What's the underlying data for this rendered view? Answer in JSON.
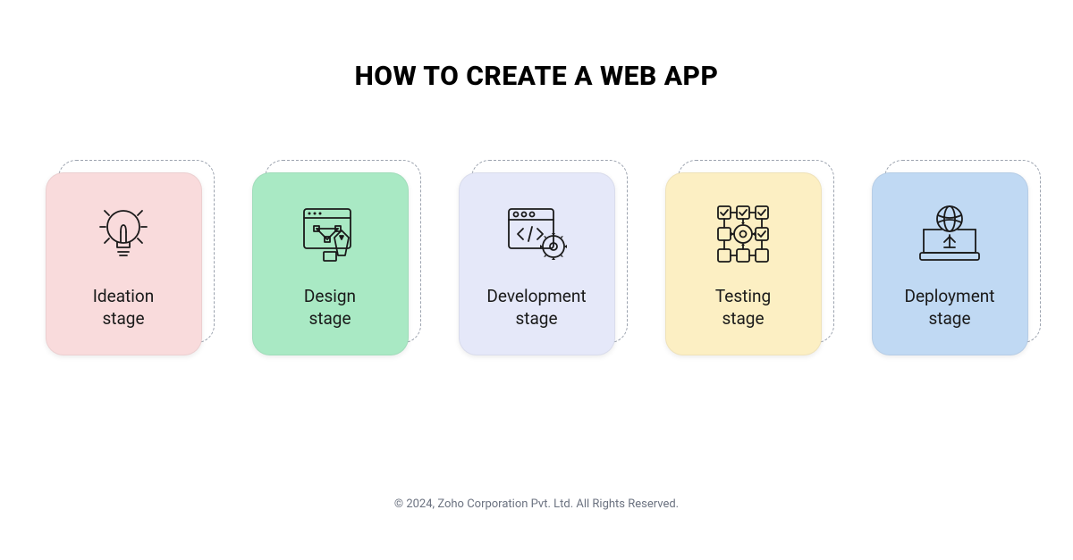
{
  "title": "HOW TO CREATE A WEB APP",
  "stages": [
    {
      "label": "Ideation\nstage",
      "color": "pink",
      "icon": "lightbulb-icon"
    },
    {
      "label": "Design\nstage",
      "color": "green",
      "icon": "design-icon"
    },
    {
      "label": "Development\nstage",
      "color": "lavender",
      "icon": "code-icon"
    },
    {
      "label": "Testing\nstage",
      "color": "yellow",
      "icon": "testing-icon"
    },
    {
      "label": "Deployment\nstage",
      "color": "blue",
      "icon": "deployment-icon"
    }
  ],
  "footer": "© 2024, Zoho Corporation Pvt. Ltd. All Rights Reserved.",
  "colors": {
    "pink": "#f9dbdc",
    "green": "#a9e9c4",
    "lavender": "#e5e8f9",
    "yellow": "#fcefc3",
    "blue": "#c0d9f3"
  }
}
